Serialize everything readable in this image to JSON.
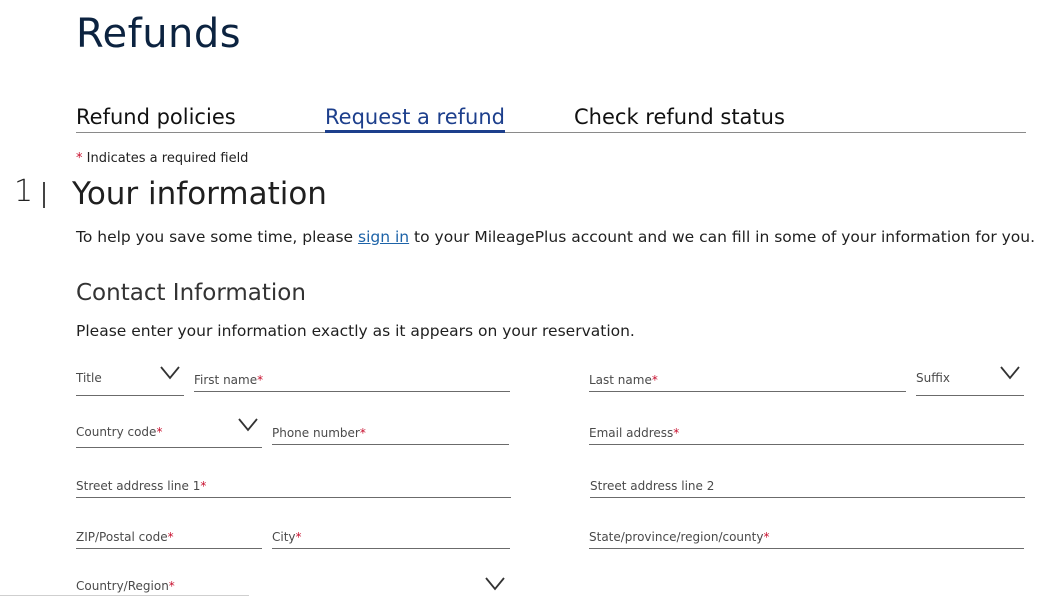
{
  "page": {
    "title": "Refunds"
  },
  "tabs": [
    {
      "label": "Refund policies",
      "active": false
    },
    {
      "label": "Request a refund",
      "active": true
    },
    {
      "label": "Check refund status",
      "active": false
    }
  ],
  "required_note": {
    "asterisk": "*",
    "text": " Indicates a required field"
  },
  "step": {
    "number": "1",
    "title": "Your information",
    "intro_before": "To help you save some time, please ",
    "intro_link": "sign in",
    "intro_after": " to your MileagePlus account and we can fill in some of your information for you."
  },
  "contact": {
    "title": "Contact Information",
    "instructions": "Please enter your information exactly as it appears on your reservation."
  },
  "fields": {
    "title": {
      "label": "Title",
      "required": ""
    },
    "first_name": {
      "label": "First name",
      "required": "*"
    },
    "last_name": {
      "label": "Last name",
      "required": "*"
    },
    "suffix": {
      "label": "Suffix",
      "required": ""
    },
    "country_code": {
      "label": "Country code",
      "required": "*"
    },
    "phone": {
      "label": "Phone number",
      "required": "*"
    },
    "email": {
      "label": "Email address",
      "required": "*"
    },
    "street1": {
      "label": "Street address line 1",
      "required": "*"
    },
    "street2": {
      "label": "Street address line 2",
      "required": ""
    },
    "zip": {
      "label": "ZIP/Postal code",
      "required": "*"
    },
    "city": {
      "label": "City",
      "required": "*"
    },
    "state": {
      "label": "State/province/region/county",
      "required": "*"
    },
    "country_region": {
      "label": "Country/Region",
      "required": "*"
    }
  },
  "colors": {
    "brand_navy": "#0c2340",
    "link_blue": "#1d63a8",
    "active_tab": "#1d3f8c",
    "required_red": "#c8102e"
  },
  "icons": {
    "dropdown": "chevron-down-icon"
  }
}
